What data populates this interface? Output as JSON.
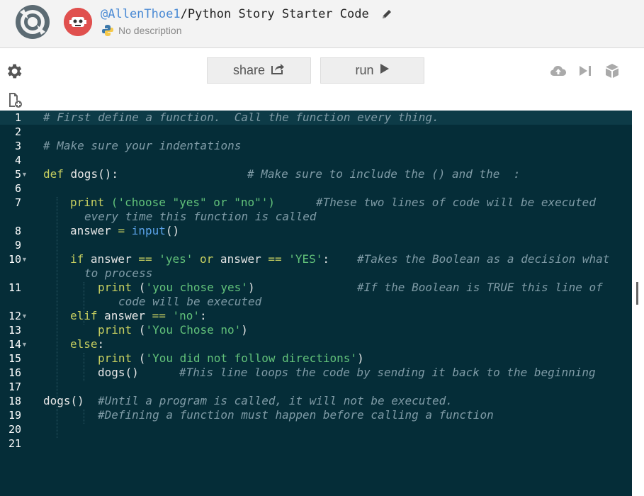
{
  "header": {
    "owner": "@AllenThoe1",
    "separator": "/",
    "repl_name": "Python Story Starter Code",
    "description": "No description"
  },
  "toolbar": {
    "share_label": "share",
    "run_label": "run"
  },
  "icons": {
    "logo": "repl-logo-icon",
    "avatar": "robot-avatar-icon",
    "edit": "pencil-icon",
    "language": "python-icon",
    "settings": "gear-icon",
    "new_file": "new-file-icon",
    "share": "share-icon",
    "run": "play-icon",
    "upload": "cloud-upload-icon",
    "step": "step-forward-icon",
    "package": "package-icon"
  },
  "colors": {
    "editor_bg": "#052d38",
    "comment": "#7f9ba6",
    "keyword": "#c8d060",
    "string": "#62c27a",
    "builtin": "#5aa2e8",
    "owner_link": "#4a8ad4",
    "avatar": "#e0504e"
  },
  "editor": {
    "line_numbers": [
      "1",
      "2",
      "3",
      "4",
      "5",
      "6",
      "7",
      "8",
      "9",
      "10",
      "11",
      "12",
      "13",
      "14",
      "15",
      "16",
      "17",
      "18",
      "19",
      "20",
      "21"
    ],
    "lines": {
      "l1": "# First define a function.  Call the function every thing.",
      "l3": "# Make sure your indentations",
      "l5_def": "def",
      "l5_name": " dogs():",
      "l5_comment": "# Make sure to include the () and the  :",
      "l7_print": "print",
      "l7_args_a": " ('",
      "l7_str": "choose \"yes\" or \"no\"",
      "l7_args_b": "')",
      "l7_comment": "#These two lines of code will be executed",
      "l7_wrap": "every time this function is called",
      "l8_var": "answer ",
      "l8_eq": "=",
      "l8_input": " input",
      "l8_paren": "()",
      "l10_if": "if",
      "l10_a": " answer ",
      "l10_eq1": "==",
      "l10_s1": " 'yes'",
      "l10_or": " or",
      "l10_b": " answer ",
      "l10_eq2": "==",
      "l10_s2": " 'YES'",
      "l10_colon": ":",
      "l10_comment": "#Takes the Boolean as a decision what",
      "l10_wrap": "to process",
      "l11_print": "print",
      "l11_open": " (",
      "l11_str": "'you chose yes'",
      "l11_close": ")",
      "l11_comment": "#If the Boolean is TRUE this line of",
      "l11_wrap": "code will be executed",
      "l12_elif": "elif",
      "l12_a": " answer ",
      "l12_eq": "==",
      "l12_str": " 'no'",
      "l12_colon": ":",
      "l13_print": "print",
      "l13_open": " (",
      "l13_str": "'You Chose no'",
      "l13_close": ")",
      "l14_else": "else",
      "l14_colon": ":",
      "l15_print": "print",
      "l15_open": " (",
      "l15_str": "'You did not follow directions'",
      "l15_close": ")",
      "l16_call": "dogs()",
      "l16_comment": "#This line loops the code by sending it back to the beginning",
      "l18_call": "dogs()",
      "l18_comment": "#Until a program is called, it will not be executed.",
      "l19_comment": "#Defining a function must happen before calling a function"
    }
  }
}
